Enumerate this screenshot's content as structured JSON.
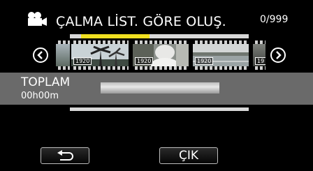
{
  "header": {
    "title": "ÇALMA LİST. GÖRE OLUŞ.",
    "counter": "0/999",
    "icon": "video-camera-icon"
  },
  "timeline": {
    "position_fraction": 0.41
  },
  "thumbnails": [
    {
      "badge": "1920",
      "scene": "palm-trees"
    },
    {
      "badge": "1920",
      "scene": "person-portrait"
    },
    {
      "badge": "1920",
      "scene": "lake-landscape"
    },
    {
      "badge": "19",
      "scene": "partial"
    }
  ],
  "navigation": {
    "prev_icon": "chevron-left-icon",
    "next_icon": "chevron-right-icon"
  },
  "summary": {
    "total_label": "TOPLAM",
    "total_time": "00h00m"
  },
  "buttons": {
    "back_icon": "return-arrow-icon",
    "exit_label": "ÇIK"
  }
}
